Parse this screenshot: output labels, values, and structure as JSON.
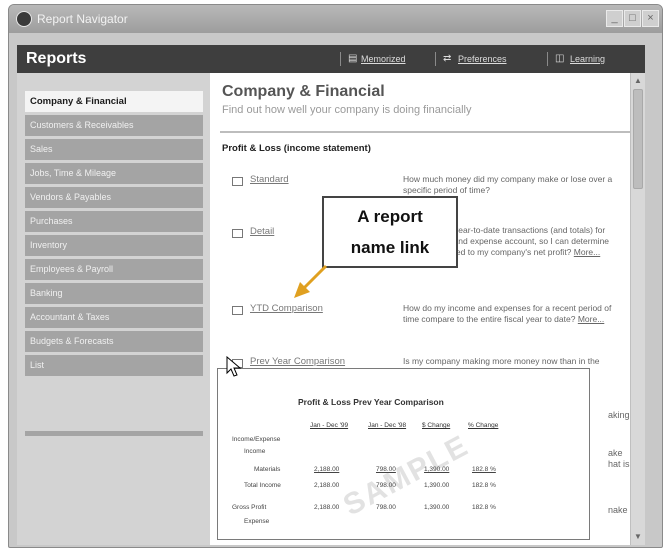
{
  "window": {
    "title": "Report Navigator",
    "buttons": [
      "_",
      "□",
      "×"
    ]
  },
  "header": {
    "title": "Reports",
    "links": [
      {
        "icon": "memorized-icon",
        "label": "Memorized"
      },
      {
        "icon": "preferences-icon",
        "label": "Preferences"
      },
      {
        "icon": "learning-icon",
        "label": "Learning"
      }
    ]
  },
  "sidebar": {
    "items": [
      {
        "label": "Company & Financial",
        "active": true
      },
      {
        "label": "Customers & Receivables"
      },
      {
        "label": "Sales"
      },
      {
        "label": "Jobs, Time & Mileage"
      },
      {
        "label": "Vendors & Payables"
      },
      {
        "label": "Purchases"
      },
      {
        "label": "Inventory"
      },
      {
        "label": "Employees & Payroll"
      },
      {
        "label": "Banking"
      },
      {
        "label": "Accountant & Taxes"
      },
      {
        "label": "Budgets & Forecasts"
      },
      {
        "label": "List"
      }
    ]
  },
  "main": {
    "title": "Company & Financial",
    "subtitle": "Find out how well your company is doing financially",
    "section_title": "Profit & Loss (income statement)",
    "reports": [
      {
        "name": "Standard",
        "desc": "How much money did my company make or lose over a specific period of time?"
      },
      {
        "name": "Detail",
        "desc": "What are the year-to-date transactions (and totals) for each income and expense account, so I can determine what contributed to my company's net profit?",
        "more": "More..."
      },
      {
        "name": "YTD Comparison",
        "desc": "How do my income and expenses for a recent period of time compare to the entire fiscal year to date?",
        "more": "More..."
      },
      {
        "name": "Prev Year Comparison",
        "desc": "Is my company making more money now than in the same period a year ago?"
      }
    ],
    "right_fragments": [
      "aking",
      "ake",
      "hat is",
      "nake"
    ]
  },
  "callout": {
    "line1": "A report",
    "line2": "name link"
  },
  "popup": {
    "title": "Profit & Loss Prev Year Comparison",
    "columns": [
      "Jan - Dec '99",
      "Jan - Dec '98",
      "$ Change",
      "% Change"
    ],
    "rows": [
      {
        "label": "Income/Expense",
        "values": [
          "",
          "",
          "",
          ""
        ]
      },
      {
        "label": "Income",
        "values": [
          "",
          "",
          "",
          ""
        ]
      },
      {
        "label": "Materials",
        "values": [
          "2,188.00",
          "798.00",
          "1,390.00",
          "182.8 %"
        ]
      },
      {
        "label": "Total Income",
        "values": [
          "2,188.00",
          "798.00",
          "1,390.00",
          "182.8 %"
        ]
      },
      {
        "label": "Gross Profit",
        "values": [
          "2,188.00",
          "798.00",
          "1,390.00",
          "182.8 %"
        ]
      },
      {
        "label": "Expense",
        "values": [
          "",
          "",
          "",
          ""
        ]
      }
    ],
    "watermark": "SAMPLE"
  }
}
